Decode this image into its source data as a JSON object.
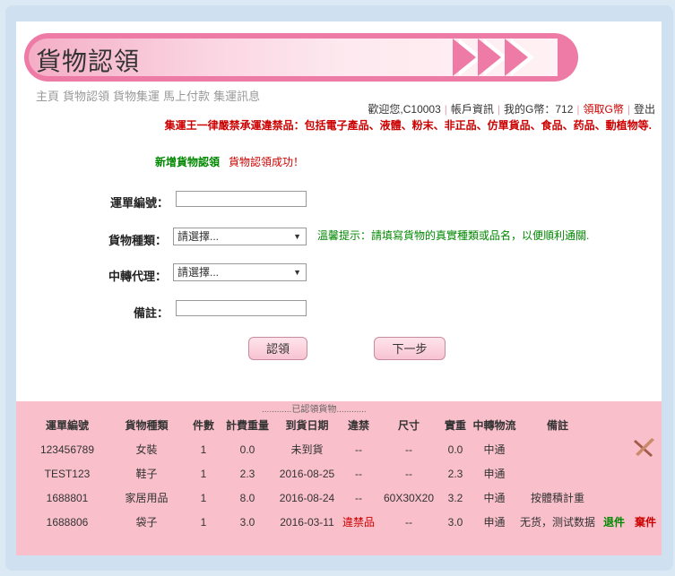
{
  "page": {
    "title": "貨物認領"
  },
  "nav": [
    "主頁",
    "貨物認領",
    "貨物集運",
    "馬上付款",
    "集運訊息"
  ],
  "userbar": {
    "welcome": "歡迎您,C10003",
    "account": "帳戶資訊",
    "balance": "我的G幣：712",
    "get_coins": "領取G幣",
    "logout": "登出"
  },
  "notice": "集運王一律嚴禁承運違禁品：包括電子產品、液體、粉末、非正品、仿單貨品、食品、药品、動植物等.",
  "status": {
    "new_claim": "新增貨物認領",
    "success": "貨物認領成功！"
  },
  "form": {
    "tracking_label": "運單編號：",
    "type_label": "貨物種類：",
    "type_value": "請選擇...",
    "agent_label": "中轉代理：",
    "agent_value": "請選擇...",
    "note_label": "備註：",
    "hint": "溫馨提示：請填寫貨物的真實種類或品名，以便順利通關.",
    "claim_button": "認領",
    "next_button": "下一步"
  },
  "claimed": {
    "title": "............已認領貨物............",
    "headers": [
      "運單編號",
      "貨物種類",
      "件數",
      "計費重量",
      "到貨日期",
      "違禁",
      "尺寸",
      "實重",
      "中轉物流",
      "備註"
    ],
    "rows": [
      [
        "123456789",
        "女裝",
        "1",
        "0.0",
        "未到貨",
        "--",
        "--",
        "0.0",
        "中通",
        ""
      ],
      [
        "TEST123",
        "鞋子",
        "1",
        "2.3",
        "2016-08-25",
        "--",
        "--",
        "2.3",
        "申通",
        ""
      ],
      [
        "1688801",
        "家居用品",
        "1",
        "8.0",
        "2016-08-24",
        "--",
        "60X30X20",
        "3.2",
        "中通",
        "按體積計重"
      ],
      [
        "1688806",
        "袋子",
        "1",
        "3.0",
        "2016-03-11",
        "違禁品",
        "--",
        "3.0",
        "申通",
        "无货，测试数据"
      ]
    ],
    "return_label": "退件",
    "abandon_label": "棄件"
  },
  "colors": {
    "accent": "#ee7aa6",
    "lower_bg": "#f9c0cb",
    "warning": "#cc0000",
    "ok": "#008800"
  }
}
